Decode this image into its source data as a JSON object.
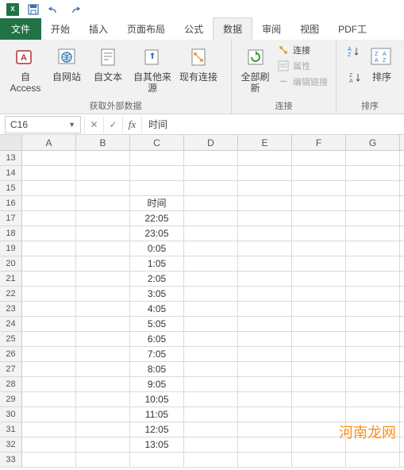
{
  "qat": {
    "excel": "X"
  },
  "tabs": {
    "file": "文件",
    "items": [
      "开始",
      "插入",
      "页面布局",
      "公式",
      "数据",
      "审阅",
      "视图",
      "PDF工"
    ],
    "activeIndex": 4
  },
  "ribbon": {
    "g1": {
      "access": "自 Access",
      "web": "自网站",
      "text": "自文本",
      "other": "自其他来源",
      "existing": "现有连接",
      "label": "获取外部数据"
    },
    "g2": {
      "refresh": "全部刷新",
      "conn": "连接",
      "prop": "属性",
      "edit": "编辑链接",
      "label": "连接"
    },
    "g3": {
      "sort": "排序",
      "label": "排序"
    }
  },
  "namebox": "C16",
  "formula": "时间",
  "columns": [
    "A",
    "B",
    "C",
    "D",
    "E",
    "F",
    "G"
  ],
  "rows": [
    {
      "n": 13,
      "c": ""
    },
    {
      "n": 14,
      "c": ""
    },
    {
      "n": 15,
      "c": ""
    },
    {
      "n": 16,
      "c": "时间"
    },
    {
      "n": 17,
      "c": "22:05"
    },
    {
      "n": 18,
      "c": "23:05"
    },
    {
      "n": 19,
      "c": "0:05"
    },
    {
      "n": 20,
      "c": "1:05"
    },
    {
      "n": 21,
      "c": "2:05"
    },
    {
      "n": 22,
      "c": "3:05"
    },
    {
      "n": 23,
      "c": "4:05"
    },
    {
      "n": 24,
      "c": "5:05"
    },
    {
      "n": 25,
      "c": "6:05"
    },
    {
      "n": 26,
      "c": "7:05"
    },
    {
      "n": 27,
      "c": "8:05"
    },
    {
      "n": 28,
      "c": "9:05"
    },
    {
      "n": 29,
      "c": "10:05"
    },
    {
      "n": 30,
      "c": "11:05"
    },
    {
      "n": 31,
      "c": "12:05"
    },
    {
      "n": 32,
      "c": "13:05"
    },
    {
      "n": 33,
      "c": ""
    }
  ],
  "watermark": "河南龙网"
}
